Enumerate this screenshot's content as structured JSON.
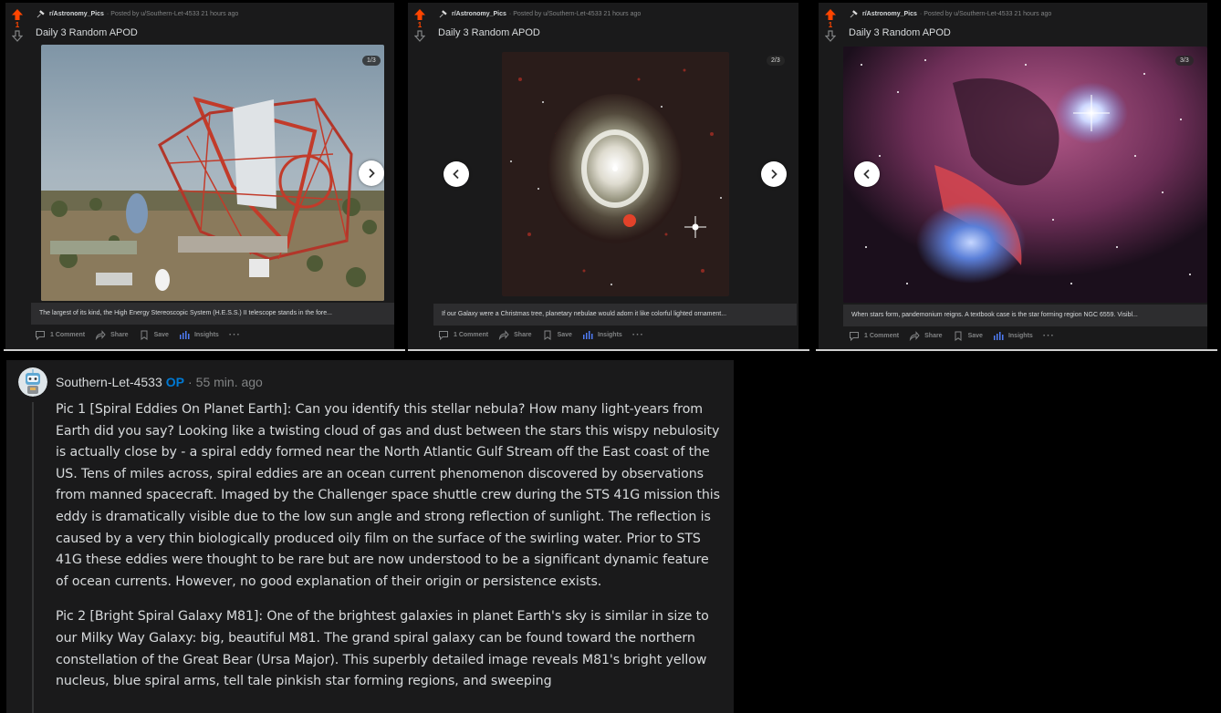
{
  "posts": [
    {
      "vote_count": "1",
      "subreddit": "r/Astronomy_Pics",
      "posted_by": "· Posted by u/Southern-Let-4533 21 hours ago",
      "title": "Daily 3 Random APOD",
      "counter": "1/3",
      "caption": "The largest of its kind, the High Energy Stereoscopic System (H.E.S.S.) II telescope stands in the fore...",
      "comments_label": "1 Comment",
      "share_label": "Share",
      "save_label": "Save",
      "insights_label": "Insights",
      "more_label": "···"
    },
    {
      "vote_count": "1",
      "subreddit": "r/Astronomy_Pics",
      "posted_by": "· Posted by u/Southern-Let-4533 21 hours ago",
      "title": "Daily 3 Random APOD",
      "counter": "2/3",
      "caption": "If our Galaxy were a Christmas tree, planetary nebulae would adorn it like colorful lighted ornament...",
      "comments_label": "1 Comment",
      "share_label": "Share",
      "save_label": "Save",
      "insights_label": "Insights",
      "more_label": "···"
    },
    {
      "vote_count": "1",
      "subreddit": "r/Astronomy_Pics",
      "posted_by": "· Posted by u/Southern-Let-4533 21 hours ago",
      "title": "Daily 3 Random APOD",
      "counter": "3/3",
      "caption": "When stars form, pandemonium reigns. A textbook case is the star forming region NGC 6559. Visibl...",
      "comments_label": "1 Comment",
      "share_label": "Share",
      "save_label": "Save",
      "insights_label": "Insights",
      "more_label": "···"
    }
  ],
  "comment": {
    "author": "Southern-Let-4533",
    "op_badge": "OP",
    "separator": "·",
    "time": "55 min. ago",
    "paragraphs": [
      "Pic 1 [Spiral Eddies On Planet Earth]: Can you identify this stellar nebula? How many light-years from Earth did you say? Looking like a twisting cloud of gas and dust between the stars this wispy nebulosity is actually close by - a spiral eddy formed near the North Atlantic Gulf Stream off the East coast of the US. Tens of miles across, spiral eddies are an ocean current phenomenon discovered by observations from manned spacecraft. Imaged by the Challenger space shuttle crew during the STS 41G mission this eddy is dramatically visible due to the low sun angle and strong reflection of sunlight. The reflection is caused by a very thin biologically produced oily film on the surface of the swirling water. Prior to STS 41G these eddies were thought to be rare but are now understood to be a significant dynamic feature of ocean currents. However, no good explanation of their origin or persistence exists.",
      "Pic 2 [Bright Spiral Galaxy M81]: One of the brightest galaxies in planet Earth's sky is similar in size to our Milky Way Galaxy: big, beautiful M81. The grand spiral galaxy can be found toward the northern constellation of the Great Bear (Ursa Major). This superbly detailed image reveals M81's bright yellow nucleus, blue spiral arms, tell tale pinkish star forming regions, and sweeping"
    ]
  },
  "colors": {
    "upvote": "#ff4500",
    "op_badge": "#0079d3",
    "panel_bg": "#1a1a1b",
    "page_bg": "#000000",
    "muted_text": "#818384"
  },
  "icons": {
    "upvote": "arrow-up-icon",
    "downvote": "arrow-down-icon",
    "subreddit": "telescope-icon",
    "next": "chevron-right-icon",
    "prev": "chevron-left-icon",
    "comment": "comment-icon",
    "share": "share-icon",
    "save": "bookmark-icon",
    "insights": "bar-chart-icon",
    "avatar": "robot-avatar"
  }
}
